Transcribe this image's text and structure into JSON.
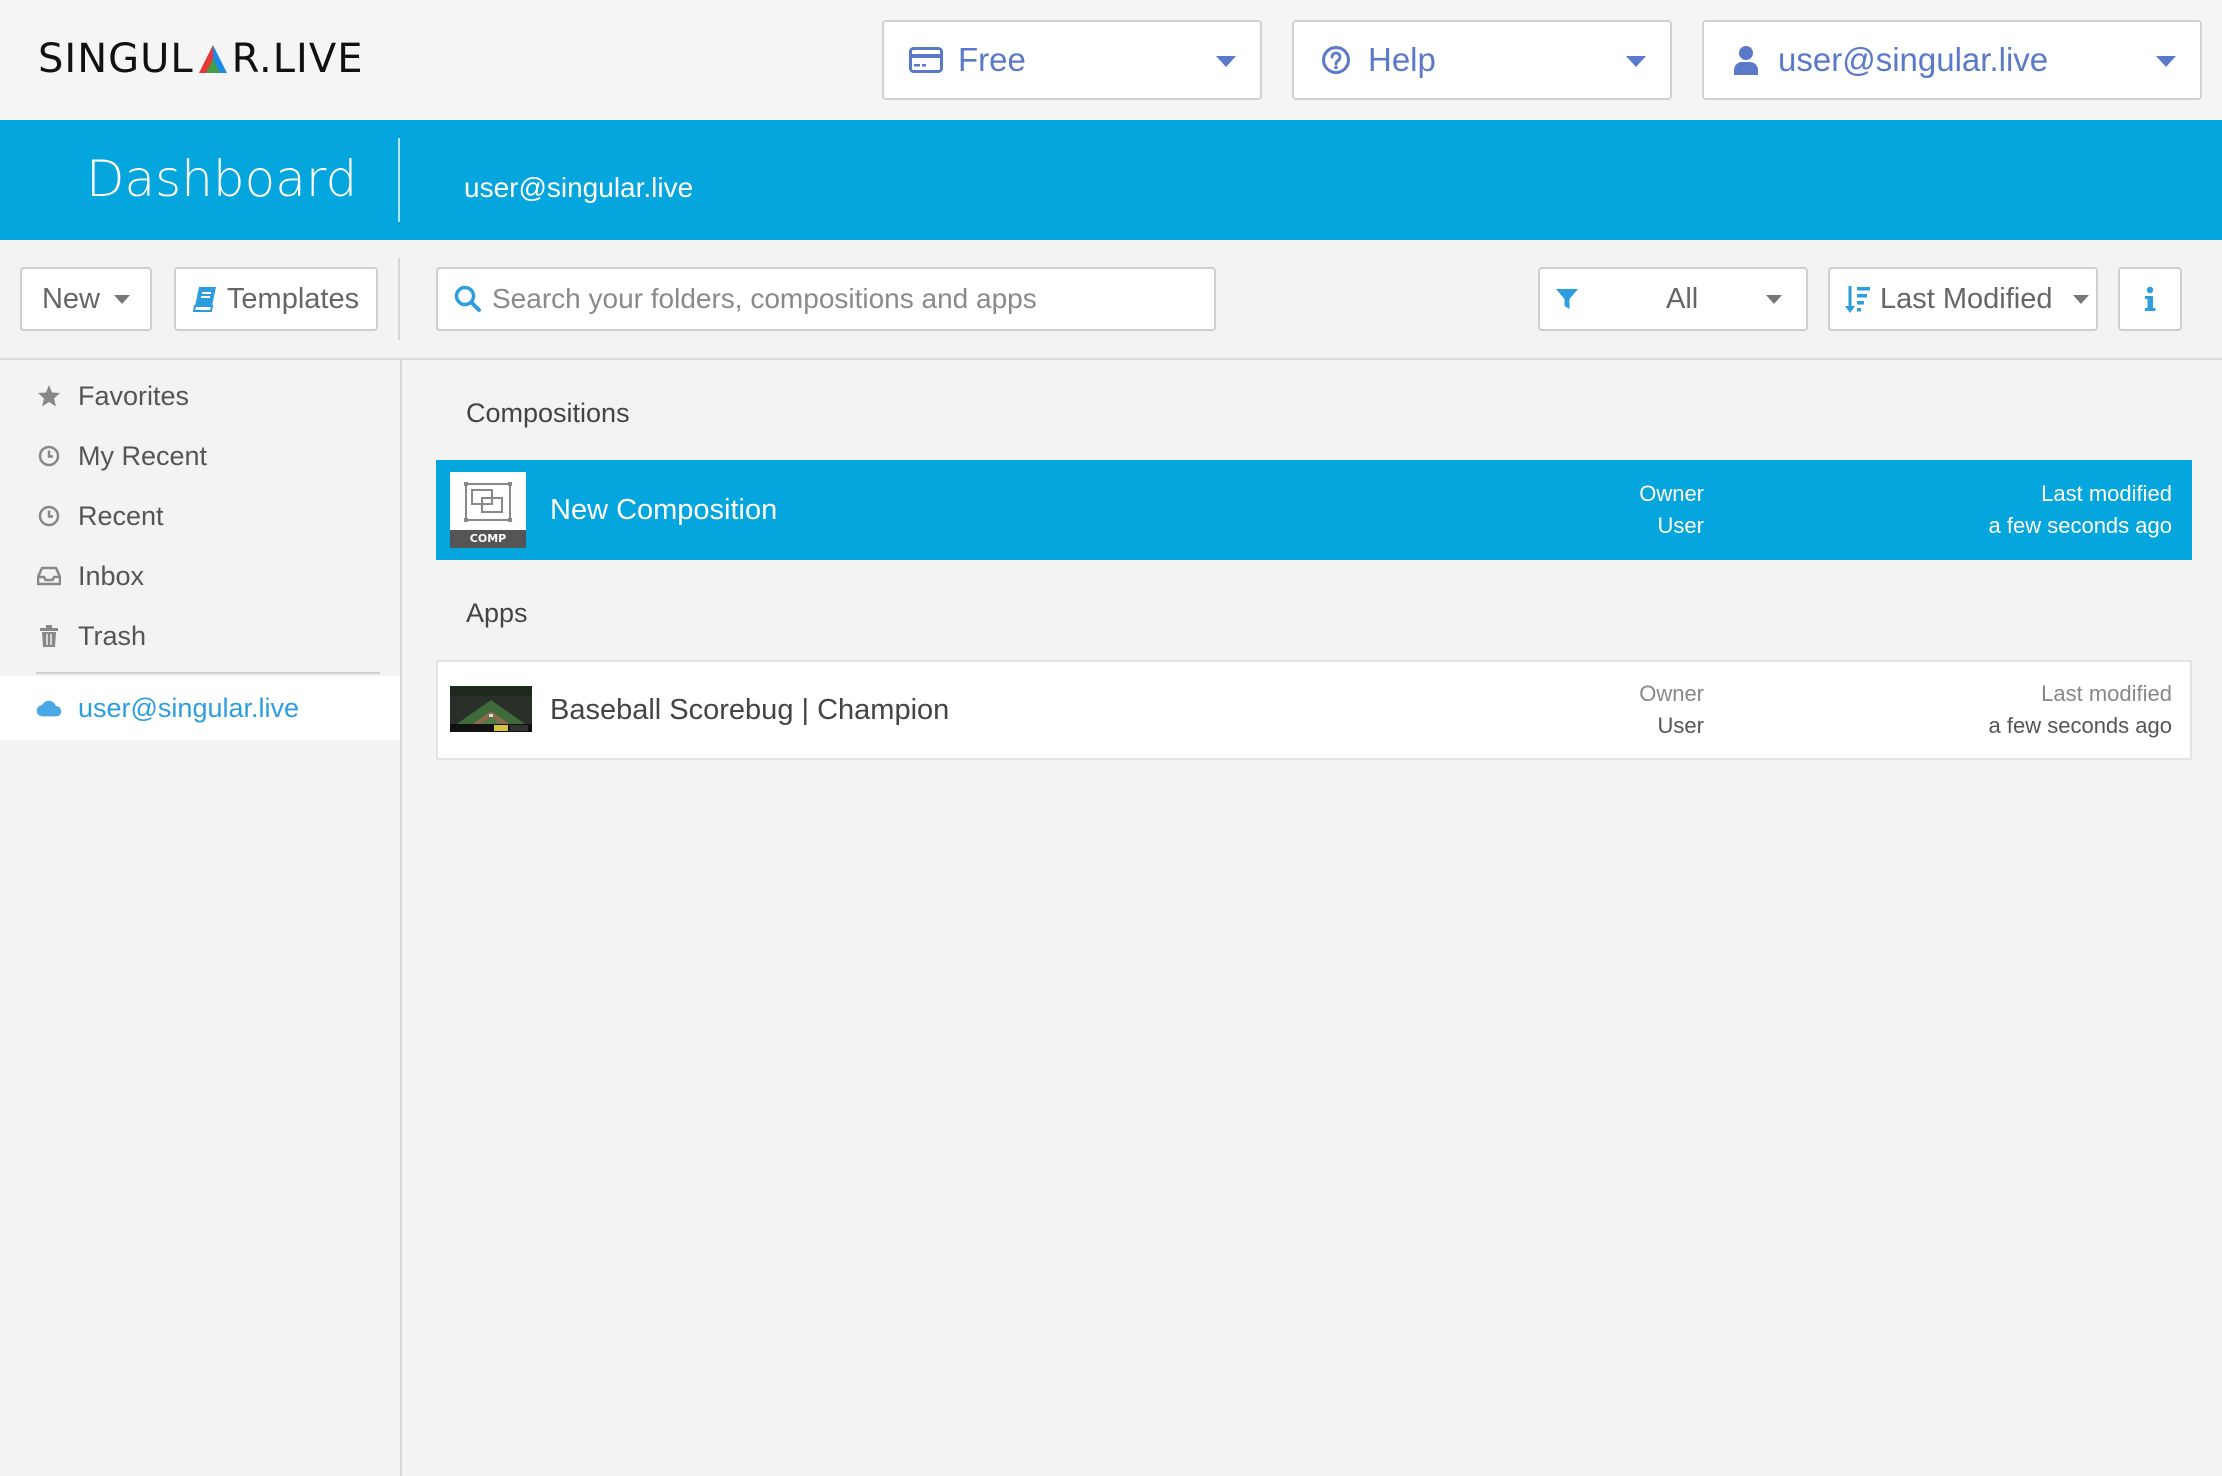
{
  "brand": {
    "logo_left": "SINGUL",
    "logo_right": "R.LIVE",
    "logo_colors": [
      "#e53935",
      "#43a047",
      "#1e88e5"
    ]
  },
  "topbar": {
    "plan": {
      "label": "Free",
      "icon": "credit-card-icon"
    },
    "help": {
      "label": "Help",
      "icon": "question-circle-icon"
    },
    "account": {
      "label": "user@singular.live",
      "icon": "user-icon"
    }
  },
  "header": {
    "title": "Dashboard",
    "user": "user@singular.live",
    "background": "#05a5dd"
  },
  "toolbar": {
    "new_label": "New",
    "templates_label": "Templates",
    "search_placeholder": "Search your folders, compositions and apps",
    "filter_value": "All",
    "sort_value": "Last Modified",
    "accent": "#2c9ee0"
  },
  "sidebar": {
    "items": [
      {
        "label": "Favorites",
        "icon": "star-icon"
      },
      {
        "label": "My Recent",
        "icon": "clock-icon"
      },
      {
        "label": "Recent",
        "icon": "clock-icon"
      },
      {
        "label": "Inbox",
        "icon": "inbox-icon"
      },
      {
        "label": "Trash",
        "icon": "trash-icon"
      }
    ],
    "account_item": {
      "label": "user@singular.live",
      "icon": "cloud-icon"
    }
  },
  "main": {
    "compositions": {
      "title": "Compositions",
      "items": [
        {
          "name": "New Composition",
          "thumb_label": "COMP",
          "owner_label": "Owner",
          "owner_value": "User",
          "modified_label": "Last modified",
          "modified_value": "a few seconds ago"
        }
      ]
    },
    "apps": {
      "title": "Apps",
      "items": [
        {
          "name": "Baseball Scorebug | Champion",
          "owner_label": "Owner",
          "owner_value": "User",
          "modified_label": "Last modified",
          "modified_value": "a few seconds ago"
        }
      ]
    }
  }
}
